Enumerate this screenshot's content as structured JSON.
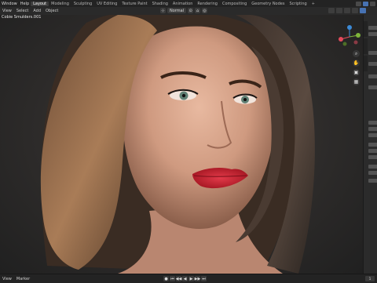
{
  "topbar": {
    "menus": [
      "Window",
      "Help"
    ],
    "workspaces": [
      "Layout",
      "Modeling",
      "Sculpting",
      "UV Editing",
      "Texture Paint",
      "Shading",
      "Animation",
      "Rendering",
      "Compositing",
      "Geometry Nodes",
      "Scripting"
    ],
    "active_workspace": "Layout",
    "add_tab": "+"
  },
  "header": {
    "menus": [
      "View",
      "Select",
      "Add",
      "Object"
    ],
    "orientation": "Normal"
  },
  "viewport": {
    "object_name": "Cobie Smulders.001"
  },
  "gizmo": {
    "z": "Z",
    "y": "Y",
    "x": "X"
  },
  "timeline": {
    "menus": [
      "View",
      "Marker"
    ],
    "controls": [
      "⏮",
      "◀◀",
      "◀",
      "▶",
      "▶▶",
      "⏭"
    ],
    "frame": "1"
  },
  "colors": {
    "accent": "#4772b3",
    "x_axis": "#e34a5a",
    "y_axis": "#7fb53a",
    "z_axis": "#3c8ad6",
    "lips": "#c71f2e"
  }
}
